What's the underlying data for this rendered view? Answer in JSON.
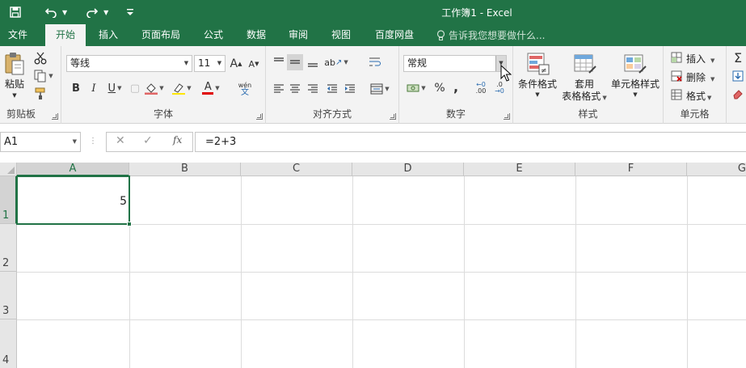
{
  "window": {
    "title": "工作簿1 - Excel"
  },
  "qat": {
    "save_icon": "save-icon",
    "undo_icon": "undo-icon",
    "redo_icon": "redo-icon",
    "customize_icon": "customize-qat-icon"
  },
  "tabs": [
    "文件",
    "开始",
    "插入",
    "页面布局",
    "公式",
    "数据",
    "审阅",
    "视图",
    "百度网盘"
  ],
  "active_tab": "开始",
  "tell_me": {
    "placeholder": "告诉我您想要做什么..."
  },
  "ribbon": {
    "clipboard": {
      "label": "剪贴板",
      "paste": "粘贴"
    },
    "font": {
      "label": "字体",
      "font_name": "等线",
      "font_size": "11",
      "bold": "B",
      "italic": "I",
      "underline": "U",
      "font_color_glyph": "A",
      "phonetic": "wén"
    },
    "alignment": {
      "label": "对齐方式"
    },
    "number": {
      "label": "数字",
      "format": "常规",
      "percent": "%",
      "comma": ",",
      "inc_decimal": ".00",
      "dec_decimal": ".0"
    },
    "styles": {
      "label": "样式",
      "conditional": "条件格式",
      "table_line1": "套用",
      "table_line2": "表格格式",
      "cell_styles": "单元格样式"
    },
    "cells": {
      "label": "单元格",
      "insert": "插入",
      "delete": "删除",
      "format": "格式"
    }
  },
  "formula_bar": {
    "name_box": "A1",
    "formula": "=2+3",
    "fx": "fx"
  },
  "grid": {
    "columns": [
      "A",
      "B",
      "C",
      "D",
      "E",
      "F",
      "G"
    ],
    "rows": [
      "1",
      "2",
      "3",
      "4"
    ],
    "selected_cell": "A1",
    "cells": {
      "A1": "5"
    }
  },
  "colors": {
    "accent": "#217346",
    "ribbon_bg": "#f3f3f3",
    "font_color_bar": "#e00000"
  }
}
